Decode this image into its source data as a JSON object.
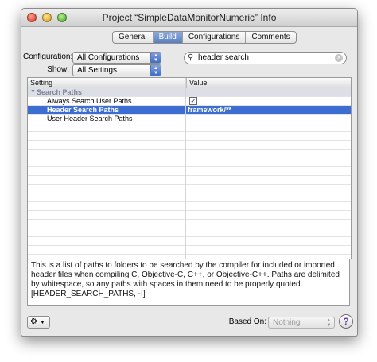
{
  "window": {
    "title": "Project “SimpleDataMonitorNumeric” Info"
  },
  "tabs": [
    {
      "label": "General",
      "selected": false
    },
    {
      "label": "Build",
      "selected": true
    },
    {
      "label": "Configurations",
      "selected": false
    },
    {
      "label": "Comments",
      "selected": false
    }
  ],
  "filters": {
    "configuration_label": "Configuration:",
    "configuration_value": "All Configurations",
    "show_label": "Show:",
    "show_value": "All Settings",
    "search_value": "header search"
  },
  "table": {
    "headers": {
      "setting": "Setting",
      "value": "Value"
    },
    "group": "Search Paths",
    "rows": [
      {
        "setting": "Always Search User Paths",
        "value": "",
        "checked": true,
        "selected": false
      },
      {
        "setting": "Header Search Paths",
        "value": "framework/**",
        "selected": true
      },
      {
        "setting": "User Header Search Paths",
        "value": "",
        "selected": false
      }
    ]
  },
  "description": "This is a list of paths to folders to be searched by the compiler for included or imported header files when compiling C, Objective-C, C++, or Objective-C++. Paths are delimited by whitespace, so any paths with spaces in them need to be properly quoted. [HEADER_SEARCH_PATHS, -I]",
  "footer": {
    "based_on_label": "Based On:",
    "based_on_value": "Nothing",
    "help_label": "?"
  },
  "icons": {
    "gear": "gear-icon",
    "search": "search-icon",
    "clear": "clear-search-icon",
    "disclosure": "disclosure-triangle-icon"
  }
}
